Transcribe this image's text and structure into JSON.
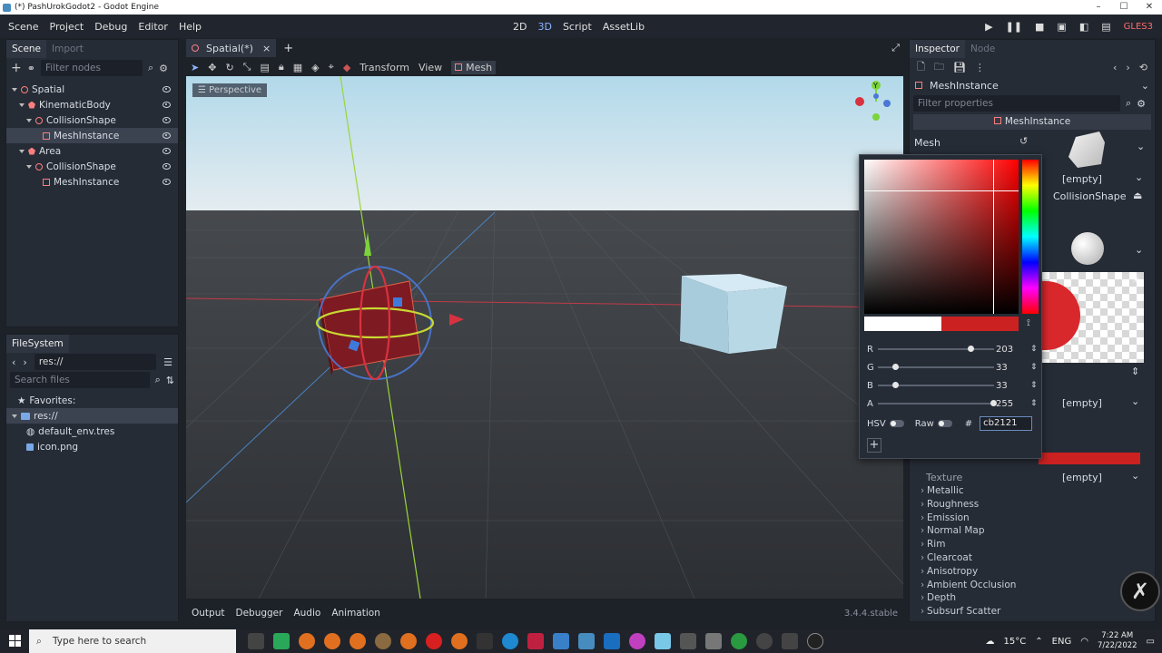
{
  "window": {
    "title": "(*) PashUrokGodot2 - Godot Engine",
    "controls": [
      "–",
      "☐",
      "✕"
    ]
  },
  "menu": [
    "Scene",
    "Project",
    "Debug",
    "Editor",
    "Help"
  ],
  "workspaces": [
    {
      "label": "2D",
      "active": false
    },
    {
      "label": "3D",
      "active": true
    },
    {
      "label": "Script",
      "active": false
    },
    {
      "label": "AssetLib",
      "active": false
    }
  ],
  "renderer": "GLES3",
  "scene_dock": {
    "tabs": [
      "Scene",
      "Import"
    ],
    "filter_placeholder": "Filter nodes",
    "tree": [
      {
        "label": "Spatial",
        "depth": 0,
        "icon": "circle-node-icon",
        "selected": false
      },
      {
        "label": "KinematicBody",
        "depth": 1,
        "icon": "kinematic-body-icon",
        "selected": false
      },
      {
        "label": "CollisionShape",
        "depth": 2,
        "icon": "collision-shape-icon",
        "selected": false
      },
      {
        "label": "MeshInstance",
        "depth": 3,
        "icon": "mesh-instance-icon",
        "selected": true
      },
      {
        "label": "Area",
        "depth": 1,
        "icon": "area-icon",
        "selected": false
      },
      {
        "label": "CollisionShape",
        "depth": 2,
        "icon": "collision-shape-icon",
        "selected": false
      },
      {
        "label": "MeshInstance",
        "depth": 3,
        "icon": "mesh-instance-icon",
        "selected": false
      }
    ]
  },
  "filesystem": {
    "title": "FileSystem",
    "path": "res://",
    "search_placeholder": "Search files",
    "favorites": "Favorites:",
    "items": [
      {
        "label": "res://",
        "type": "folder"
      },
      {
        "label": "default_env.tres",
        "type": "env"
      },
      {
        "label": "icon.png",
        "type": "image"
      }
    ]
  },
  "editor_tab": {
    "label": "Spatial(*)",
    "close": "×",
    "add": "+"
  },
  "viewport_toolbar": {
    "transform": "Transform",
    "view": "View",
    "mesh": "Mesh"
  },
  "viewport": {
    "perspective": "Perspective",
    "gizmo": {
      "y": "Y"
    }
  },
  "bottom_panel": {
    "tabs": [
      "Output",
      "Debugger",
      "Audio",
      "Animation"
    ],
    "version": "3.4.4.stable"
  },
  "inspector": {
    "tabs": [
      "Inspector",
      "Node"
    ],
    "node": "MeshInstance",
    "filter_placeholder": "Filter properties",
    "section": "MeshInstance",
    "mesh_label": "Mesh",
    "empty1": "[empty]",
    "collision": "CollisionShape",
    "empty2": "[empty]",
    "texture_label": "Texture",
    "empty3": "[empty]",
    "albedo_color": "#cb2121",
    "sections": [
      "Metallic",
      "Roughness",
      "Emission",
      "Normal Map",
      "Rim",
      "Clearcoat",
      "Anisotropy",
      "Ambient Occlusion",
      "Depth",
      "Subsurf Scatter"
    ]
  },
  "color_picker": {
    "r": {
      "label": "R",
      "value": 203
    },
    "g": {
      "label": "G",
      "value": 33
    },
    "b": {
      "label": "B",
      "value": 33
    },
    "a": {
      "label": "A",
      "value": 255
    },
    "hsv": "HSV",
    "raw": "Raw",
    "hash": "#",
    "hex": "cb2121",
    "add": "+",
    "old_color": "#ffffff",
    "new_color": "#cb2121"
  },
  "taskbar": {
    "search": "Type here to search",
    "temp": "15°C",
    "lang": "ENG",
    "time": "7:22 AM",
    "date": "7/22/2022"
  }
}
